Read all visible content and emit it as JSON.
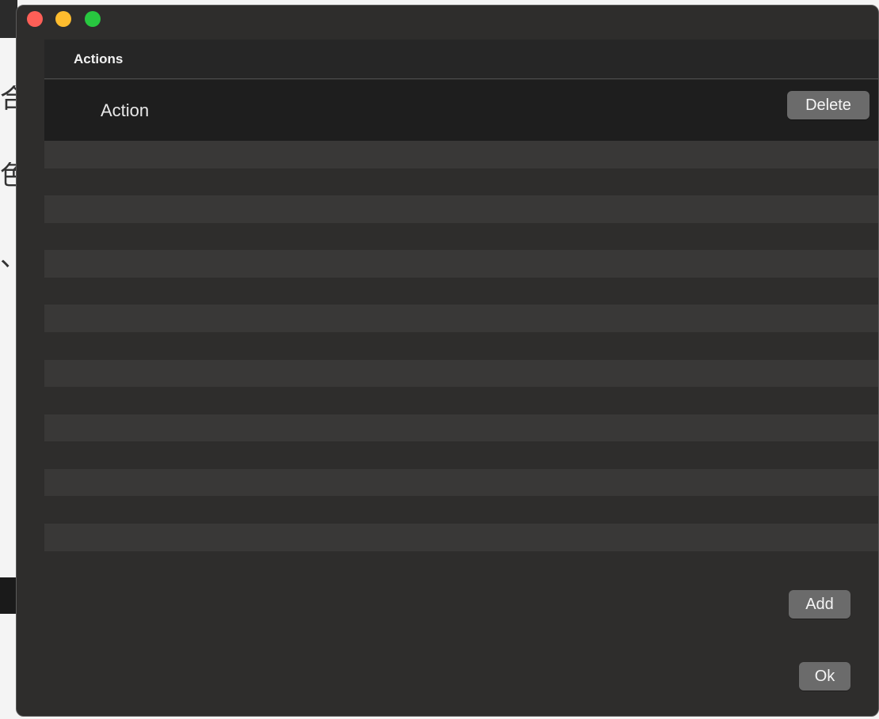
{
  "background": {
    "glyphs": [
      "合",
      "色",
      "、"
    ]
  },
  "window": {
    "buttons": {
      "close_icon": "close-icon",
      "minimize_icon": "minimize-icon",
      "zoom_icon": "zoom-icon"
    },
    "colors": {
      "close": "#fe5f57",
      "minimize": "#febc2e",
      "zoom": "#28c840"
    }
  },
  "table": {
    "header": "Actions",
    "rows": [
      {
        "label": "Action",
        "delete_label": "Delete",
        "selected": true
      }
    ]
  },
  "footer": {
    "add_label": "Add",
    "ok_label": "Ok"
  }
}
